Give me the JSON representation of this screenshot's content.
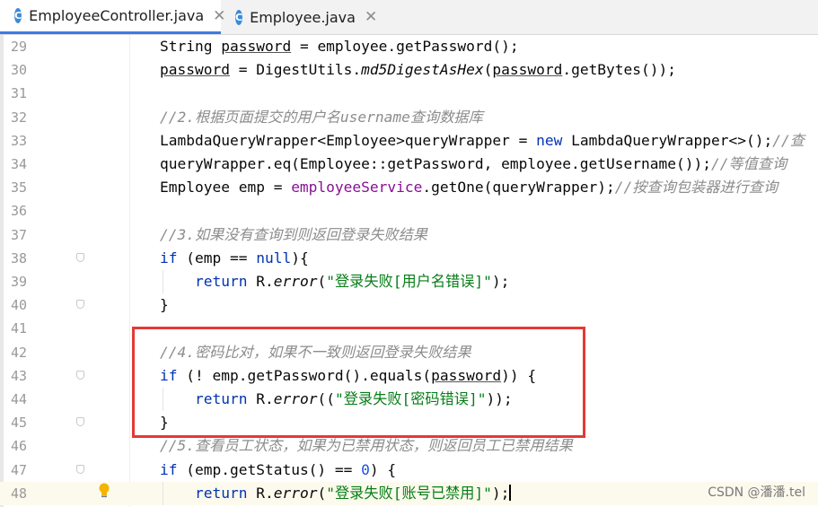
{
  "tabs": [
    {
      "label": "EmployeeController.java",
      "icon": "C",
      "active": true
    },
    {
      "label": "Employee.java",
      "icon": "C",
      "active": false
    }
  ],
  "lines": [
    {
      "num": "29",
      "html": "String <span class=\"ul\">password</span> = employee.getPassword();"
    },
    {
      "num": "30",
      "html": "<span class=\"ul\">password</span> = DigestUtils.<span class=\"italic\">md5DigestAsHex</span>(<span class=\"ul\">password</span>.getBytes());"
    },
    {
      "num": "31",
      "html": ""
    },
    {
      "num": "32",
      "html": "<span class=\"cmt\">//2.根据页面提交的用户名username查询数据库</span>"
    },
    {
      "num": "33",
      "html": "LambdaQueryWrapper&lt;Employee&gt;queryWrapper = <span class=\"kw\">new</span> LambdaQueryWrapper&lt;&gt;();<span class=\"cmt\">//查</span>"
    },
    {
      "num": "34",
      "html": "queryWrapper.eq(Employee::getPassword, employee.getUsername());<span class=\"cmt\">//等值查询</span>"
    },
    {
      "num": "35",
      "html": "Employee emp = <span class=\"field\">employeeService</span>.getOne(queryWrapper);<span class=\"cmt\">//按查询包装器进行查询</span>"
    },
    {
      "num": "36",
      "html": ""
    },
    {
      "num": "37",
      "html": "<span class=\"cmt\">//3.如果没有查询到则返回登录失败结果</span>"
    },
    {
      "num": "38",
      "html": "<span class=\"kw\">if</span> (emp == <span class=\"kw\">null</span>){",
      "fold": true
    },
    {
      "num": "39",
      "html": "    <span class=\"kw\">return</span> R.<span class=\"italic\">error</span>(<span class=\"str\">\"登录失败[用户名错误]\"</span>);"
    },
    {
      "num": "40",
      "html": "}",
      "fold": true
    },
    {
      "num": "41",
      "html": ""
    },
    {
      "num": "42",
      "html": "<span class=\"cmt\">//4.密码比对，如果不一致则返回登录失败结果</span>"
    },
    {
      "num": "43",
      "html": "<span class=\"kw\">if</span> (! emp.getPassword().equals(<span class=\"ul\">password</span>)) {",
      "fold": true
    },
    {
      "num": "44",
      "html": "    <span class=\"kw\">return</span> R.<span class=\"italic\">error</span>((<span class=\"str\">\"登录失败[密码错误]\"</span>));"
    },
    {
      "num": "45",
      "html": "}",
      "fold": true
    },
    {
      "num": "46",
      "html": "<span class=\"cmt\">//5.查看员工状态，如果为已禁用状态，则返回员工已禁用结果</span>"
    },
    {
      "num": "47",
      "html": "<span class=\"kw\">if</span> (emp.getStatus() == <span class=\"num\">0</span>) {",
      "fold": true
    },
    {
      "num": "48",
      "html": "    <span class=\"kw\">return</span> R.<span class=\"italic\">error</span>(<span class=\"str\">\"登录失败[账号已禁用]\"</span>);<span class=\"caret\"></span>",
      "current": true
    }
  ],
  "watermark": "CSDN @潘潘.tel",
  "colors": {
    "keyword": "#0033b3",
    "string": "#067d17",
    "comment": "#8c8c8c",
    "highlight": "#e53935",
    "tab_accent": "#3d7be0"
  }
}
